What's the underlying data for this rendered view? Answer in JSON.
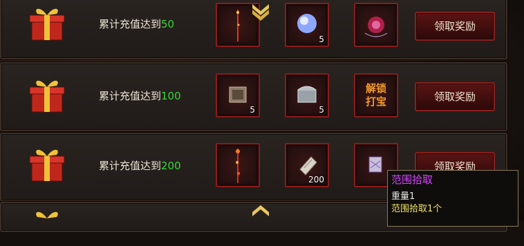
{
  "rows": [
    {
      "label": "累计充值达到",
      "amount": "50",
      "items": [
        {
          "icon": "red-sword-icon",
          "count": ""
        },
        {
          "icon": "blue-orb-icon",
          "count": "5"
        },
        {
          "icon": "purple-gem-icon",
          "count": ""
        }
      ],
      "button": "领取奖励"
    },
    {
      "label": "累计充值达到",
      "amount": "100",
      "items": [
        {
          "icon": "ornate-chest-icon",
          "count": "5"
        },
        {
          "icon": "silver-chest-icon",
          "count": "5"
        },
        {
          "icon": "unlock-treasure-icon",
          "count": "",
          "text": [
            "解锁",
            "打宝"
          ]
        }
      ],
      "button": "领取奖励"
    },
    {
      "label": "累计充值达到",
      "amount": "200",
      "items": [
        {
          "icon": "flame-staff-icon",
          "count": ""
        },
        {
          "icon": "scroll-icon",
          "count": "200"
        },
        {
          "icon": "range-pickup-icon",
          "count": ""
        }
      ],
      "button": "领取奖励"
    }
  ],
  "tooltip": {
    "title": "范围拾取",
    "weight": "重量1",
    "desc": "范围拾取1个"
  },
  "colors": {
    "amount": "#3bd43b",
    "slot_border": "#8c1b1b",
    "tooltip_title": "#d545ff",
    "tooltip_desc": "#f2e36a"
  }
}
